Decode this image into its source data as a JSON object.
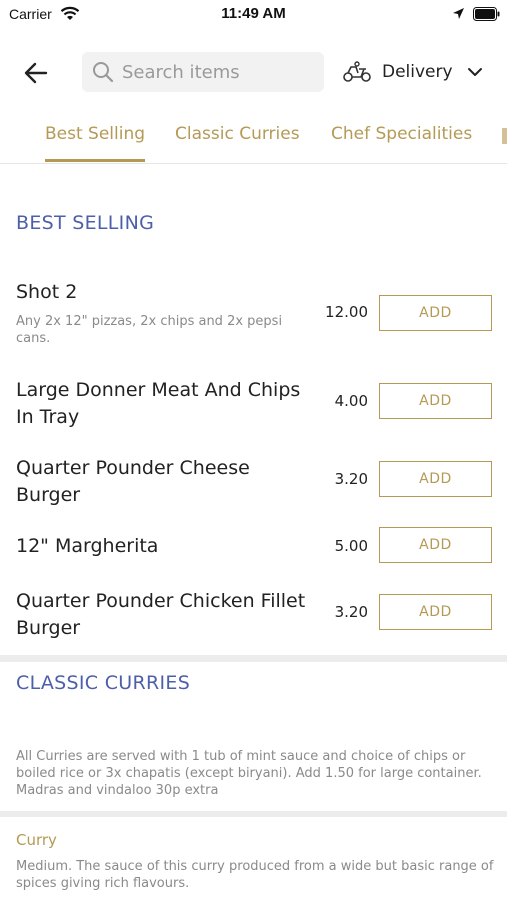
{
  "status_bar": {
    "carrier": "Carrier",
    "time": "11:49 AM"
  },
  "header": {
    "search_placeholder": "Search items",
    "delivery_label": "Delivery"
  },
  "tabs": [
    {
      "label": "Best Selling",
      "active": true
    },
    {
      "label": "Classic Curries",
      "active": false
    },
    {
      "label": "Chef Specialities",
      "active": false
    }
  ],
  "sections": [
    {
      "title": "BEST SELLING",
      "items": [
        {
          "name": "Shot 2",
          "description": "Any 2x 12\" pizzas, 2x chips and 2x pepsi cans.",
          "price": "12.00",
          "button": "ADD"
        },
        {
          "name": "Large Donner Meat And Chips In Tray",
          "price": "4.00",
          "button": "ADD"
        },
        {
          "name": "Quarter Pounder Cheese Burger",
          "price": "3.20",
          "button": "ADD"
        },
        {
          "name": "12\" Margherita",
          "price": "5.00",
          "button": "ADD"
        },
        {
          "name": "Quarter Pounder Chicken Fillet Burger",
          "price": "3.20",
          "button": "ADD"
        }
      ]
    },
    {
      "title": "CLASSIC CURRIES",
      "note": "All Curries are served with 1 tub of mint sauce and choice of chips or boiled rice or 3x chapatis (except biryani).  Add 1.50 for large container. Madras and vindaloo 30p extra",
      "subsection": {
        "title": "Curry",
        "description": "Medium. The sauce of this curry produced from a wide but basic range of spices giving rich flavours."
      }
    }
  ],
  "colors": {
    "accent_gold": "#b49a55",
    "section_blue": "#4d5fab"
  }
}
